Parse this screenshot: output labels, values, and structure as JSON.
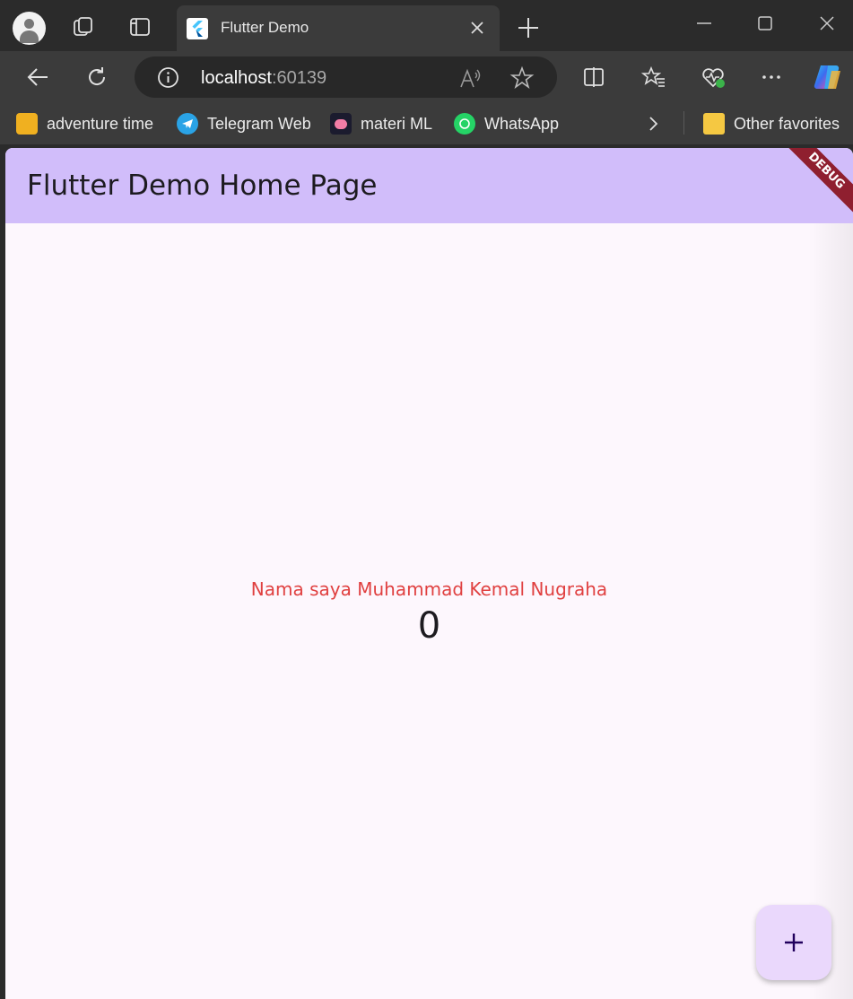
{
  "browser": {
    "tab": {
      "title": "Flutter Demo"
    },
    "address_bar": {
      "host": "localhost",
      "port": ":60139"
    },
    "bookmarks": [
      {
        "label": "adventure time",
        "icon": "adventure-time-icon",
        "color": "#f0b020"
      },
      {
        "label": "Telegram Web",
        "icon": "telegram-icon",
        "color": "#2aa3e6"
      },
      {
        "label": "materi ML",
        "icon": "brain-icon",
        "color": "#1b1b2e"
      },
      {
        "label": "WhatsApp",
        "icon": "whatsapp-icon",
        "color": "#25d366"
      }
    ],
    "other_favorites": "Other favorites"
  },
  "app": {
    "appbar_title": "Flutter Demo Home Page",
    "debug_banner": "DEBUG",
    "message": "Nama saya Muhammad Kemal Nugraha",
    "counter": "0",
    "fab_icon": "plus-icon",
    "colors": {
      "appbar": "#d1bdfa",
      "background": "#fdf7fd",
      "message": "#e04040",
      "fab": "#ead8fc"
    }
  }
}
